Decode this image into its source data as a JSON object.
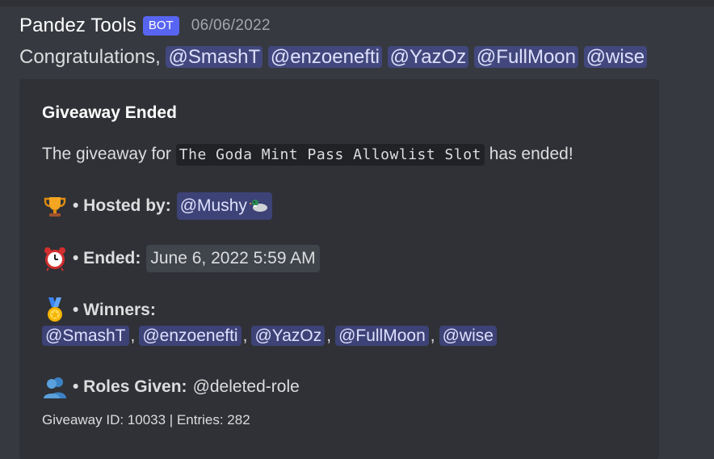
{
  "message": {
    "author": "Pandez Tools",
    "badge": "BOT",
    "timestamp": "06/06/2022",
    "content_prefix": "Congratulations, ",
    "mentions": [
      "@SmashT",
      "@enzoenefti",
      "@YazOz",
      "@FullMoon",
      "@wise"
    ]
  },
  "embed": {
    "title": "Giveaway Ended",
    "desc_prefix": "The giveaway for",
    "prize_code": "The Goda Mint Pass Allowlist Slot",
    "desc_suffix": "has ended!",
    "hosted": {
      "icon": "trophy-icon",
      "label": "• Hosted by:",
      "mention": "@Mushy",
      "mention_emoji": "duck-icon"
    },
    "ended": {
      "icon": "alarm-clock-icon",
      "label": "• Ended:",
      "value": "June 6, 2022 5:59 AM"
    },
    "winners": {
      "icon": "medal-icon",
      "label": "• Winners:",
      "list": [
        "@SmashT",
        "@enzoenefti",
        "@YazOz",
        "@FullMoon",
        "@wise"
      ],
      "separator": ","
    },
    "roles": {
      "icon": "users-icon",
      "label": "• Roles Given:",
      "value": "@deleted-role"
    },
    "footer": "Giveaway ID: 10033 | Entries: 282"
  },
  "colors": {
    "background": "#36393f",
    "embed_bg": "#2f3136",
    "bot_badge": "#5865f2",
    "mention_bg": "#3f4473",
    "mention_text": "#dee0fc"
  }
}
